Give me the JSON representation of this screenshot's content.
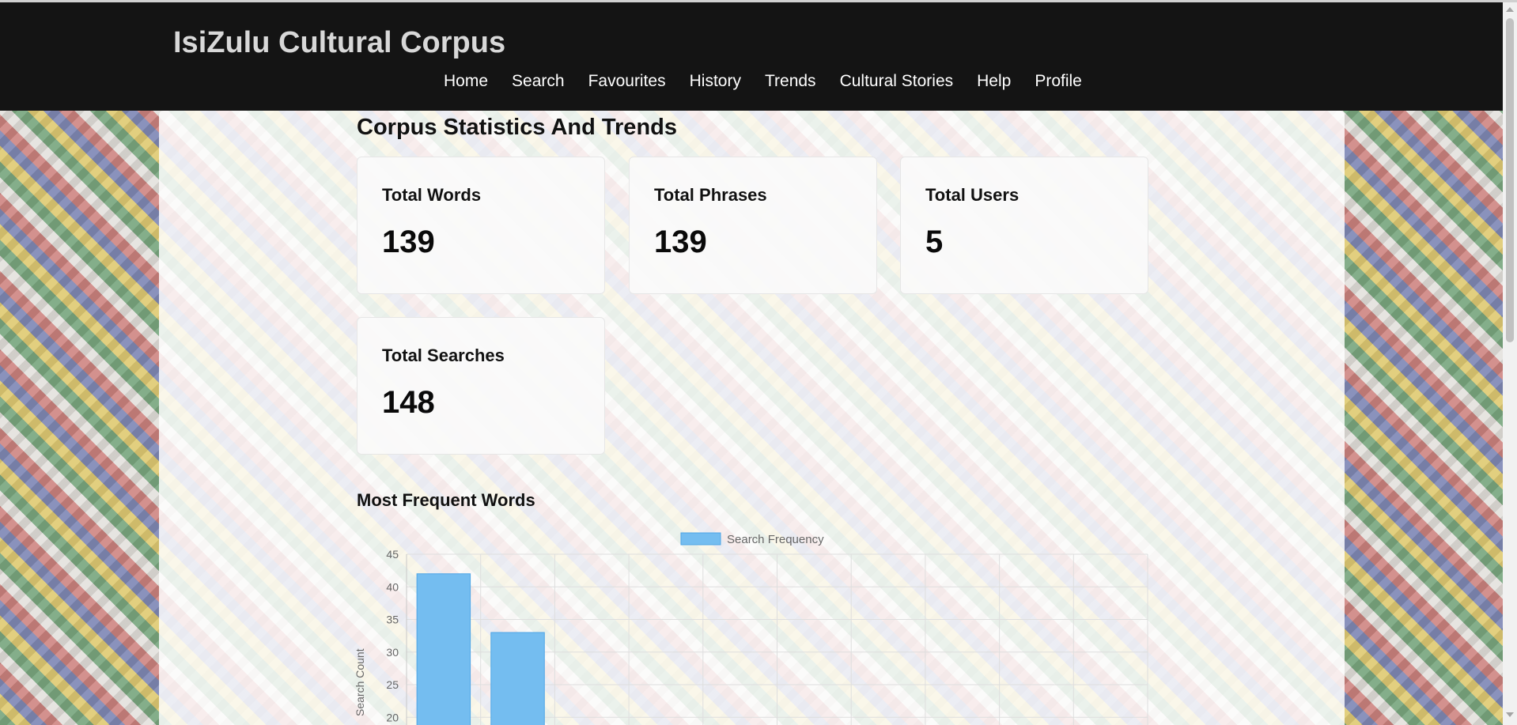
{
  "app": {
    "title": "IsiZulu Cultural Corpus"
  },
  "nav": {
    "items": [
      {
        "label": "Home"
      },
      {
        "label": "Search"
      },
      {
        "label": "Favourites"
      },
      {
        "label": "History"
      },
      {
        "label": "Trends"
      },
      {
        "label": "Cultural Stories"
      },
      {
        "label": "Help"
      },
      {
        "label": "Profile"
      }
    ]
  },
  "page": {
    "title": "Corpus Statistics And Trends"
  },
  "stats": [
    {
      "label": "Total Words",
      "value": "139"
    },
    {
      "label": "Total Phrases",
      "value": "139"
    },
    {
      "label": "Total Users",
      "value": "5"
    },
    {
      "label": "Total Searches",
      "value": "148"
    }
  ],
  "frequent_words": {
    "title": "Most Frequent Words"
  },
  "colors": {
    "bar_fill": "#74bdf0",
    "bar_stroke": "#4ea5e6",
    "header_bg": "#141414"
  },
  "chart_data": {
    "type": "bar",
    "series": [
      {
        "name": "Search Frequency",
        "values": [
          42,
          33
        ]
      }
    ],
    "ylabel": "Search Count",
    "ylim": [
      0,
      45
    ],
    "yticks": [
      20,
      25,
      30,
      35,
      40,
      45
    ],
    "category_count": 10,
    "grid": true,
    "legend": "top-center"
  }
}
